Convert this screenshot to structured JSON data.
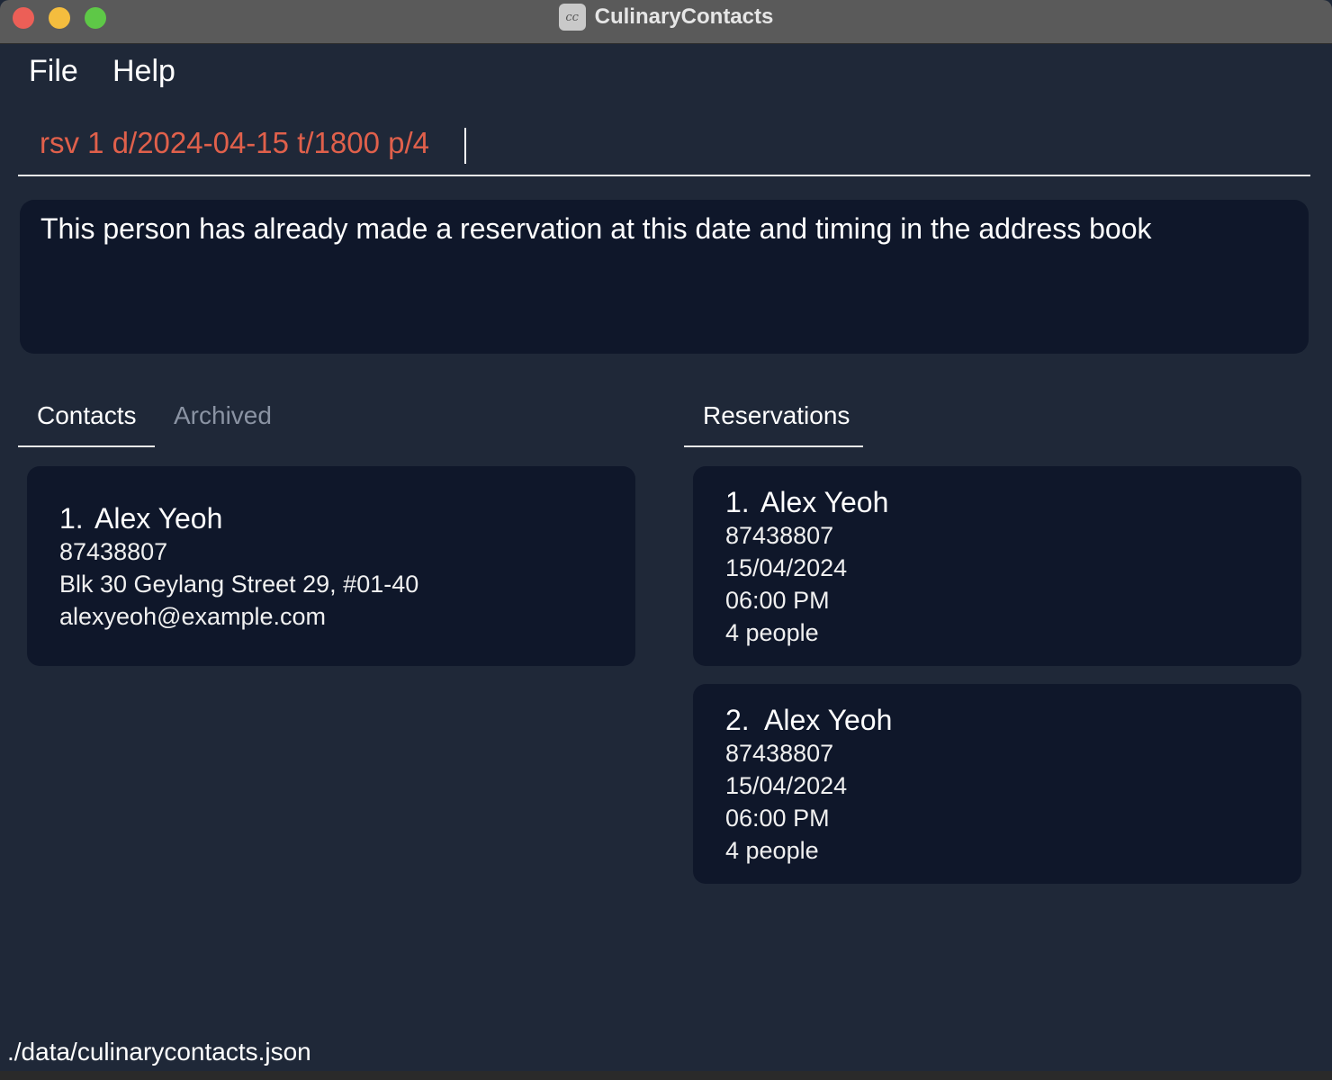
{
  "window": {
    "title": "CulinaryContacts",
    "app_icon": "culinary-app-icon"
  },
  "menu": {
    "file": "File",
    "help": "Help"
  },
  "command": {
    "value": "rsv 1 d/2024-04-15 t/1800 p/4"
  },
  "result": {
    "message": "This person has already made a reservation at this date and timing in the address book"
  },
  "tabs": {
    "contacts": "Contacts",
    "archived": "Archived",
    "reservations": "Reservations"
  },
  "contacts": [
    {
      "index": "1.",
      "name": "Alex Yeoh",
      "phone": "87438807",
      "address": "Blk 30 Geylang Street 29, #01-40",
      "email": "alexyeoh@example.com"
    }
  ],
  "reservations": [
    {
      "index": "1.",
      "name": "Alex Yeoh",
      "phone": "87438807",
      "date": "15/04/2024",
      "time": "06:00 PM",
      "pax": "4 people"
    },
    {
      "index": "2.",
      "name": "Alex Yeoh",
      "phone": "87438807",
      "date": "15/04/2024",
      "time": "06:00 PM",
      "pax": "4 people"
    }
  ],
  "status": {
    "file_path": "./data/culinarycontacts.json"
  },
  "colors": {
    "background": "#1f2838",
    "card": "#0f172a",
    "command_text": "#e0604b",
    "inactive_tab": "#8a93a3"
  }
}
